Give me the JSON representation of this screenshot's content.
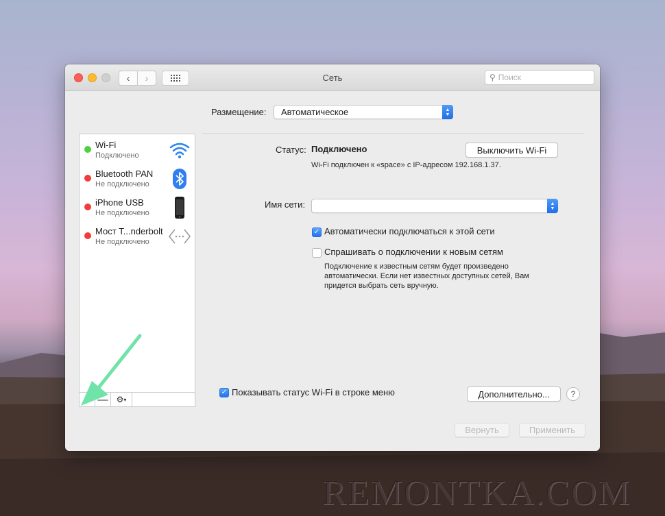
{
  "window": {
    "title": "Сеть"
  },
  "search": {
    "placeholder": "Поиск"
  },
  "location": {
    "label": "Размещение:",
    "value": "Автоматическое"
  },
  "services": [
    {
      "name": "Wi-Fi",
      "state": "Подключено",
      "status_color": "#4cd23f",
      "icon": "wifi-icon"
    },
    {
      "name": "Bluetooth PAN",
      "state": "Не подключено",
      "status_color": "#f23b3b",
      "icon": "bluetooth-icon"
    },
    {
      "name": "iPhone USB",
      "state": "Не подключено",
      "status_color": "#f23b3b",
      "icon": "iphone-icon"
    },
    {
      "name": "Мост T...nderbolt",
      "state": "Не подключено",
      "status_color": "#f23b3b",
      "icon": "thunderbolt-bridge-icon"
    }
  ],
  "sidebar_buttons": {
    "add": "+",
    "remove": "—",
    "gear": "gear-icon"
  },
  "detail": {
    "status_label": "Статус:",
    "status_value": "Подключено",
    "toggle_wifi": "Выключить Wi-Fi",
    "status_desc": "Wi-Fi подключен к «space» с IP-адресом 192.168.1.37.",
    "network_name_label": "Имя сети:",
    "network_name_value": "",
    "auto_join_label": "Автоматически подключаться к этой сети",
    "auto_join_checked": true,
    "ask_join_label": "Спрашивать о подключении к новым сетям",
    "ask_join_checked": false,
    "ask_join_help_1": "Подключение к известным сетям будет произведено",
    "ask_join_help_2": "автоматически. Если нет известных доступных сетей, Вам",
    "ask_join_help_3": "придется выбрать сеть вручную."
  },
  "footer": {
    "show_status_label": "Показывать статус Wi-Fi в строке меню",
    "show_status_checked": true,
    "advanced": "Дополнительно...",
    "help": "?",
    "revert": "Вернуть",
    "apply": "Применить"
  },
  "watermark": "REMONTKA.COM",
  "colors": {
    "accent": "#2473ee",
    "annotation_arrow": "#6fe3a8"
  }
}
